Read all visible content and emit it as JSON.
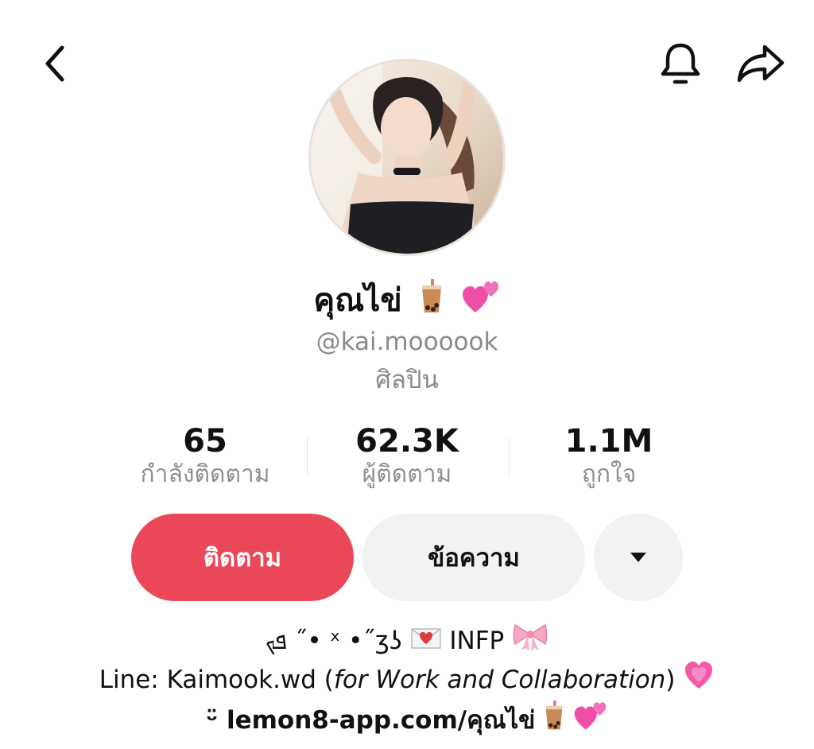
{
  "header": {
    "back_icon": "chevron-left-icon",
    "bell_icon": "bell-icon",
    "share_icon": "share-arrow-icon"
  },
  "profile": {
    "display_name": "คุณไข่",
    "handle": "@kai.moooook",
    "category": "ศิลปิน"
  },
  "stats": [
    {
      "value": "65",
      "label": "กำลังติดตาม"
    },
    {
      "value": "62.3K",
      "label": "ผู้ติดตาม"
    },
    {
      "value": "1.1M",
      "label": "ถูกใจ"
    }
  ],
  "actions": {
    "follow_label": "ติดตาม",
    "message_label": "ข้อความ",
    "more_icon": "caret-down-icon"
  },
  "bio": {
    "line1_text": "ܦܟ ˝• ˣ •˝ʒʖ",
    "line1_tag": "INFP",
    "line2_prefix": "Line: Kaimook.wd (",
    "line2_italic": "for Work and Collaboration",
    "line2_suffix": ")",
    "line3_smile": "ᵕ̈",
    "line3_link": "lemon8-app.com/คุณไข่"
  },
  "colors": {
    "follow_button": "#ea4759",
    "secondary_button": "#f2f2f2",
    "muted_text": "#8a8a8a"
  }
}
